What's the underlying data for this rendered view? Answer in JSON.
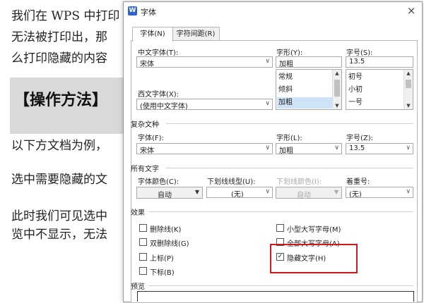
{
  "document": {
    "lines": [
      "我们在 WPS 中打印",
      "无法被打印出，那",
      "么打印隐藏的内容"
    ],
    "heading": "【操作方法】",
    "para_1": "以下方文档为例，",
    "para_2": "选中需要隐藏的文",
    "para_3a": "此时我们可见选中",
    "para_3b": "览中不显示，无法"
  },
  "dialog": {
    "title": "字体",
    "app_icon": "W",
    "close_glyph": "×",
    "tabs": [
      {
        "label": "字体(N)",
        "active": true
      },
      {
        "label": "字符间距(R)",
        "active": false
      }
    ],
    "chinese_font": {
      "label": "中文字体(T):",
      "value": "宋体"
    },
    "western_font": {
      "label": "西文字体(X):",
      "value": "(使用中文字体)"
    },
    "style": {
      "label": "字形(Y):",
      "value": "加粗",
      "options": [
        "常规",
        "倾斜",
        "加粗"
      ],
      "selected": "加粗"
    },
    "size": {
      "label": "字号(S):",
      "value": "13.5",
      "options": [
        "初号",
        "小初",
        "一号"
      ]
    },
    "complex": {
      "section": "复杂文种",
      "font_label": "字体(F):",
      "font_value": "宋体",
      "style_label": "字形(L):",
      "style_value": "加粗",
      "size_label": "字号(Z):",
      "size_value": "13.5"
    },
    "all_text": {
      "section": "所有文字",
      "color_label": "字体颜色(C):",
      "color_value": "自动",
      "underline_label": "下划线线型(U):",
      "underline_value": "(无)",
      "underline_color_label": "下划线颜色(I):",
      "underline_color_value": "自动",
      "emphasis_label": "着重号:",
      "emphasis_value": "(无)"
    },
    "effects": {
      "section": "效果",
      "strikethrough": {
        "label": "删除线(K)",
        "checked": false
      },
      "double_strikethrough": {
        "label": "双删除线(G)",
        "checked": false
      },
      "superscript": {
        "label": "上标(P)",
        "checked": false
      },
      "subscript": {
        "label": "下标(B)",
        "checked": false
      },
      "small_caps": {
        "label": "小型大写字母(M)",
        "checked": false
      },
      "all_caps": {
        "label": "全部大写字母(A)",
        "checked": false
      },
      "hidden": {
        "label": "隐藏文字(H)",
        "checked": true
      }
    },
    "preview": {
      "section": "预览"
    }
  },
  "colors": {
    "highlight": "#d0191e",
    "selection": "#cfe3f7",
    "app_icon": "#2b63d6"
  },
  "icons": {
    "close": "close-icon",
    "app": "wps-app-icon",
    "dropdown": "chevron-down-icon",
    "scroll_up": "scroll-up-icon",
    "scroll_down": "scroll-down-icon",
    "check": "check-icon"
  }
}
